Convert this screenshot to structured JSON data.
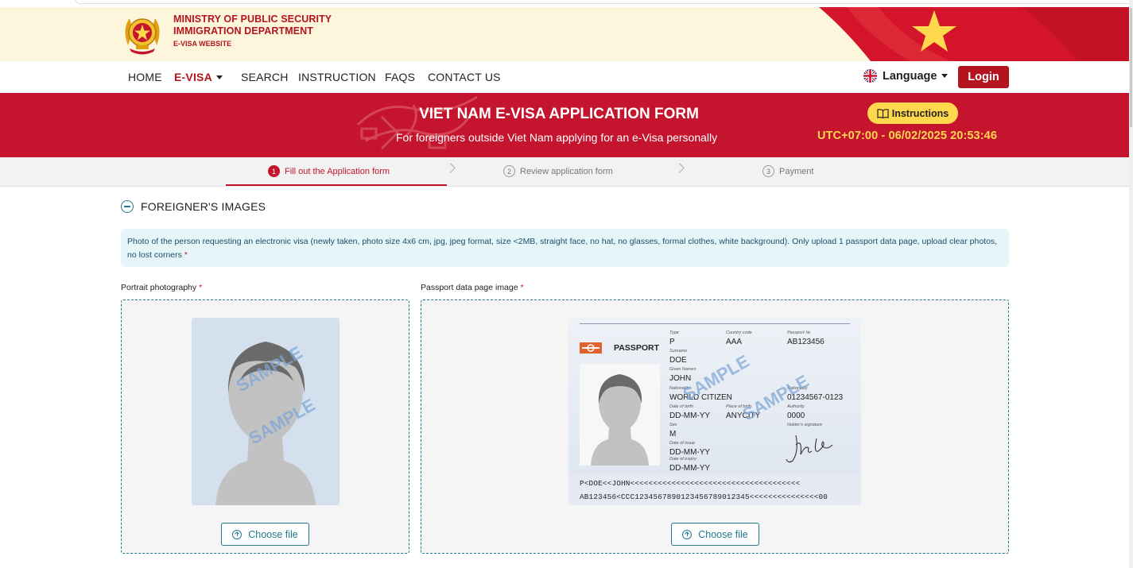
{
  "header": {
    "ministry_line1": "MINISTRY OF PUBLIC SECURITY",
    "ministry_line2": "IMMIGRATION DEPARTMENT",
    "ministry_line3": "E-VISA WEBSITE"
  },
  "nav": {
    "items": [
      "HOME",
      "E-VISA",
      "SEARCH",
      "INSTRUCTION",
      "FAQS",
      "CONTACT US"
    ],
    "active": "E-VISA",
    "language_label": "Language",
    "login_label": "Login"
  },
  "hero": {
    "title": "VIET NAM E-VISA APPLICATION FORM",
    "subtitle": "For foreigners outside Viet Nam applying for an e-Visa personally",
    "instructions_label": "Instructions",
    "clock": "UTC+07:00 - 06/02/2025 20:53:46"
  },
  "steps": [
    {
      "num": "1",
      "label": "Fill out the Application form",
      "active": true
    },
    {
      "num": "2",
      "label": "Review application form",
      "active": false
    },
    {
      "num": "3",
      "label": "Payment",
      "active": false
    }
  ],
  "section": {
    "title": "FOREIGNER'S IMAGES",
    "notice": "Photo of the person requesting an electronic visa (newly taken, photo size 4x6 cm, jpg, jpeg format, size <2MB, straight face, no hat, no glasses, formal clothes, white background). Only upload 1 passport data page, upload clear photos, no lost corners",
    "required_mark": "*"
  },
  "portrait": {
    "label": "Portrait photography",
    "choose_label": "Choose file",
    "watermark": "SAMPLE"
  },
  "passport": {
    "label": "Passport data page image",
    "choose_label": "Choose file",
    "watermark": "SAMPLE",
    "doc_title": "PASSPORT",
    "fields": {
      "type_cap": "Type",
      "type": "P",
      "country_cap": "Country code",
      "country": "AAA",
      "passno_cap": "Passport №",
      "passno": "AB123456",
      "surname_cap": "Surname",
      "surname": "DOE",
      "given_cap": "Given Names",
      "given": "JOHN",
      "nationality_cap": "Nationality",
      "nationality": "WORLD CITIZEN",
      "personal_cap": "Nationality",
      "personal": "01234567-0123",
      "dob_cap": "Date of birth",
      "dob": "DD-MM-YY",
      "pob_cap": "Place of birth",
      "pob": "ANYCITY",
      "authority_cap": "Authority",
      "authority": "0000",
      "sex_cap": "Sex",
      "sex": "M",
      "signature_cap": "Holder's signature",
      "issue_cap": "Date of issue",
      "issue": "DD-MM-YY",
      "expiry_cap": "Date of expiry",
      "expiry": "DD-MM-YY"
    },
    "mrz1": "P<DOE<<JOHN<<<<<<<<<<<<<<<<<<<<<<<<<<<<<<<<<<<<<",
    "mrz2": "AB123456<CCC1234567890123456789012345<<<<<<<<<<<<<<<00"
  },
  "colors": {
    "brand_red": "#c5142e",
    "accent_yellow": "#ffd84d",
    "teal": "#1f7a8c"
  }
}
